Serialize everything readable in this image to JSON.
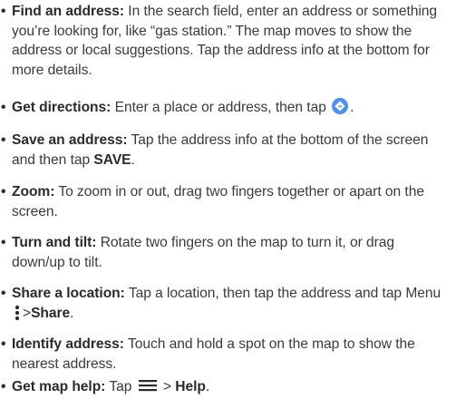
{
  "bullet_char": "•",
  "items": [
    {
      "term": "Find an address:",
      "text": "In the search field, enter an address or something you’re looking for, like “gas station.” The map moves to show the address or local suggestions. Tap the address info at the bottom for more details."
    },
    {
      "term": "Get directions:",
      "text_before": "Enter a place or address, then tap",
      "icon": "directions-diamond-icon",
      "text_after": "."
    },
    {
      "term": "Save an address:",
      "text_before": "Tap the address info at the bottom of the screen and then tap",
      "strong": "SAVE",
      "text_after": "."
    },
    {
      "term": "Zoom:",
      "text": "To zoom in or out, drag two fingers together or apart on the screen."
    },
    {
      "term": "Turn and tilt:",
      "text": "Rotate two fingers on the map to turn it, or drag down/up to tilt."
    },
    {
      "term": "Share a location:",
      "text_before": "Tap a location, then tap the address and tap Menu",
      "icon": "more-vertical-icon",
      "sep": ">",
      "strong": "Share",
      "text_after": "."
    },
    {
      "term": "Identify address:",
      "text": "Touch and hold a spot on the map to show the nearest address."
    },
    {
      "term": "Get map help:",
      "text_before": "Tap",
      "icon": "hamburger-menu-icon",
      "sep": ">",
      "strong": "Help",
      "text_after": "."
    }
  ],
  "colors": {
    "text": "#3a3a3a",
    "accent": "#4a8ff2"
  }
}
